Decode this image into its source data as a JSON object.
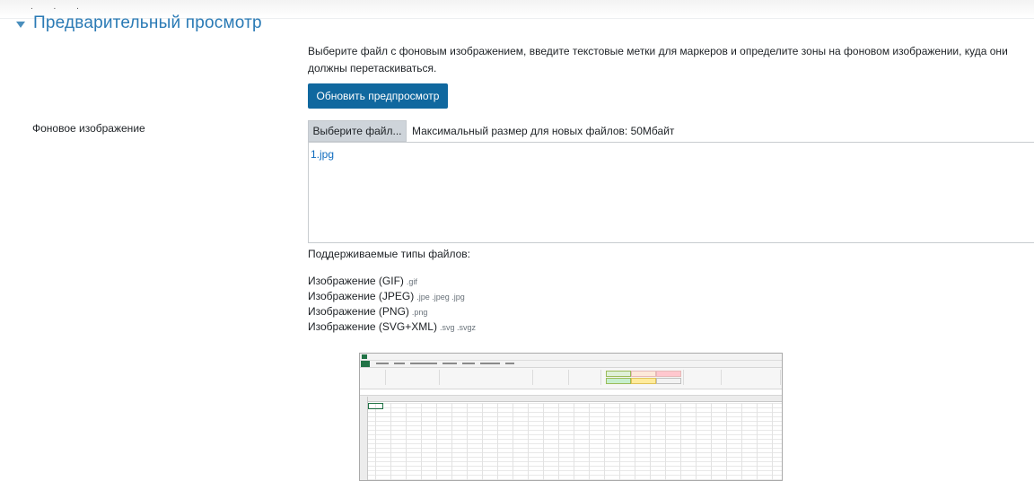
{
  "header": {
    "top_dots": ". . .",
    "section_title": "Предварительный просмотр"
  },
  "description": "Выберите файл с фоновым изображением, введите текстовые метки для маркеров и определите зоны на фоновом изображении, куда они должны перетаскиваться.",
  "refresh_button_label": "Обновить предпросмотр",
  "background_field": {
    "label": "Фоновое изображение",
    "choose_button_label": "Выберите файл...",
    "max_size_text": "Максимальный размер для новых файлов: 50Мбайт",
    "file_name": "1.jpg"
  },
  "supported": {
    "title": "Поддерживаемые типы файлов:",
    "types": [
      {
        "name": "Изображение (GIF)",
        "ext": ".gif"
      },
      {
        "name": "Изображение (JPEG)",
        "ext": ".jpe .jpeg .jpg"
      },
      {
        "name": "Изображение (PNG)",
        "ext": ".png"
      },
      {
        "name": "Изображение (SVG+XML)",
        "ext": ".svg .svgz"
      }
    ]
  },
  "colors": {
    "accent": "#0f6cbf",
    "button": "#10689f",
    "excel_green": "#217346"
  }
}
